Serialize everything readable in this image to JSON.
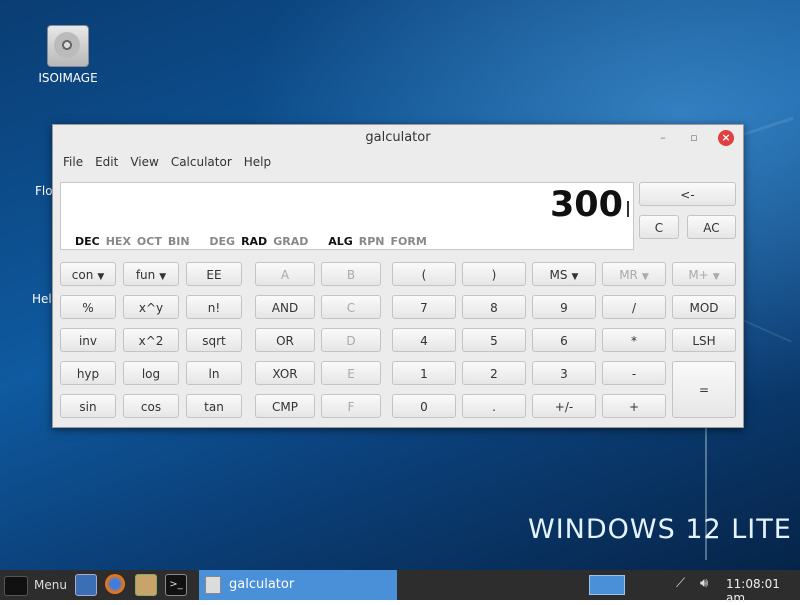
{
  "desktop": {
    "watermark": "WINDOWS 12 LITE",
    "icons": [
      {
        "label": "ISOIMAGE",
        "icon": "dvd-icon"
      }
    ],
    "partial_labels": [
      "Flo",
      "Hel"
    ]
  },
  "window": {
    "title": "galculator",
    "menu": [
      "File",
      "Edit",
      "View",
      "Calculator",
      "Help"
    ],
    "display": {
      "value": "300",
      "number_modes": [
        "DEC",
        "HEX",
        "OCT",
        "BIN"
      ],
      "active_number_mode": "DEC",
      "angle_modes": [
        "DEG",
        "RAD",
        "GRAD"
      ],
      "active_angle_mode": "RAD",
      "entry_modes": [
        "ALG",
        "RPN",
        "FORM"
      ],
      "active_entry_mode": "ALG"
    },
    "side_buttons": {
      "backspace": "<-",
      "clear": "C",
      "all_clear": "AC"
    },
    "buttons": {
      "con": "con",
      "fun": "fun",
      "ee": "EE",
      "a": "A",
      "b": "B",
      "lparen": "(",
      "rparen": ")",
      "ms": "MS",
      "mr": "MR",
      "mplus": "M+",
      "percent": "%",
      "xpowy": "x^y",
      "fact": "n!",
      "and": "AND",
      "c_hex": "C",
      "n7": "7",
      "n8": "8",
      "n9": "9",
      "div": "/",
      "mod": "MOD",
      "inv": "inv",
      "xsq": "x^2",
      "sqrt": "sqrt",
      "or": "OR",
      "d_hex": "D",
      "n4": "4",
      "n5": "5",
      "n6": "6",
      "mul": "*",
      "lsh": "LSH",
      "hyp": "hyp",
      "log": "log",
      "ln": "ln",
      "xor": "XOR",
      "e_hex": "E",
      "n1": "1",
      "n2": "2",
      "n3": "3",
      "sub": "-",
      "eq": "=",
      "sin": "sin",
      "cos": "cos",
      "tan": "tan",
      "cmp": "CMP",
      "f_hex": "F",
      "n0": "0",
      "dot": ".",
      "sign": "+/-",
      "add": "+"
    }
  },
  "taskbar": {
    "menu_label": "Menu",
    "task_label": "galculator",
    "clock": "11:08:01 am"
  },
  "colors": {
    "accent": "#4a90d9",
    "close": "#e04040",
    "taskbar": "#2d2d2d"
  }
}
